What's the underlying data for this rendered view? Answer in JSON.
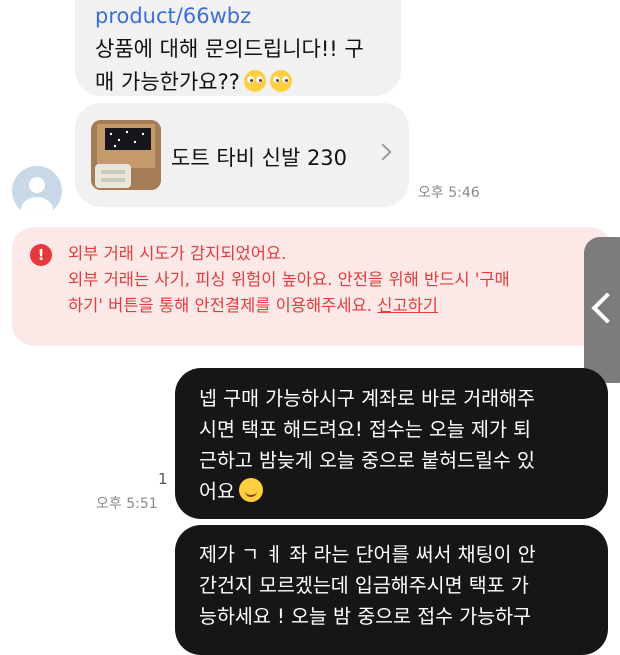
{
  "incoming": {
    "message": {
      "link": "product/66wbz",
      "line1": "상품에 대해 문의드립니다!! 구",
      "line2": "매 가능한가요??",
      "emoji": [
        "pleading-face",
        "pleading-face"
      ]
    },
    "product_card": {
      "name": "도트 타비 신발 230",
      "thumbnail": "shoe-box-photo"
    },
    "time": "오후 5:46"
  },
  "warning": {
    "icon": "exclamation-circle-icon",
    "line1": "외부 거래 시도가 감지되었어요.",
    "line2": "외부 거래는 사기, 피싱 위험이 높아요. 안전을 위해 반드시 '구매",
    "line3": "하기' 버튼을 통해 안전결제를 이용해주세요.",
    "report_link": "신고하기",
    "color": "#e23c3c",
    "background": "#fde8e8"
  },
  "outgoing": [
    {
      "lines": [
        "넵 구매 가능하시구 계좌로 바로 거래해주",
        "시면 택포 해드려요! 접수는 오늘 제가 퇴",
        "근하고 밤늦게 오늘 중으로 붙혀드릴수 있",
        "어요"
      ],
      "emoji": "smiling-face",
      "unread_count": "1",
      "time": "오후 5:51"
    },
    {
      "lines": [
        "제가 ㄱ ㅖ 좌 라는 단어를 써서 채팅이 안",
        "간건지 모르겠는데 입금해주시면 택포 가",
        "능하세요 ! 오늘 밤 중으로 접수 가능하구"
      ]
    }
  ],
  "side_handle": {
    "icon": "chevron-left-icon"
  }
}
